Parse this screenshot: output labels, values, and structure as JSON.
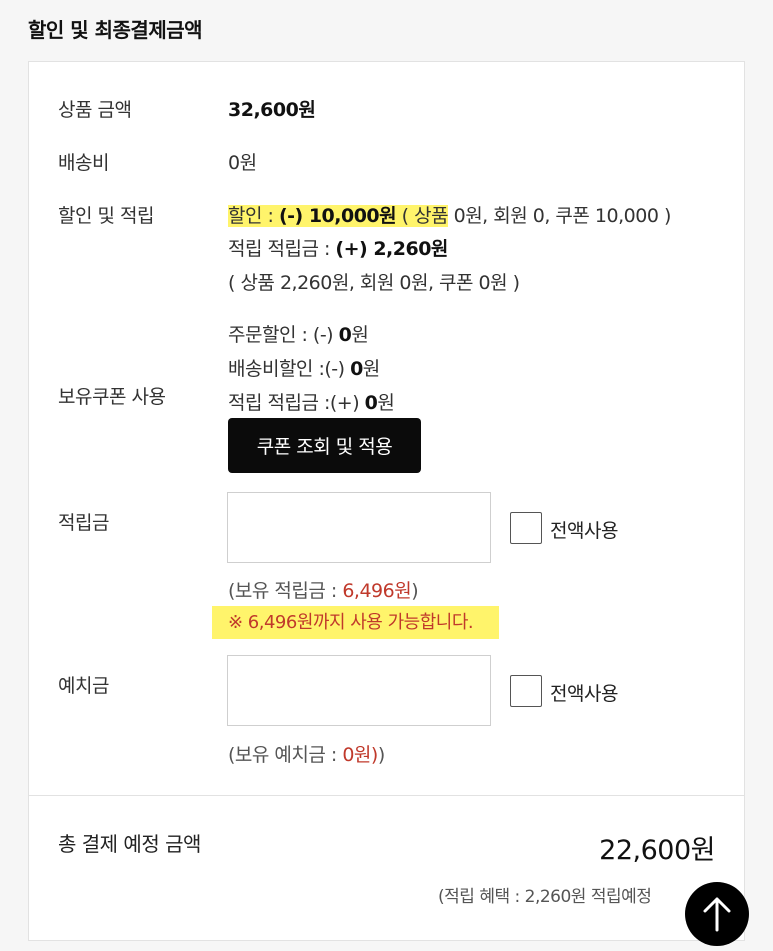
{
  "section_title": "할인 및 최종결제금액",
  "rows": {
    "product_amount": {
      "label": "상품 금액",
      "value": "32,600원"
    },
    "shipping": {
      "label": "배송비",
      "value": "0원"
    },
    "discount": {
      "label": "할인 및 적립",
      "line1_prefix": "할인 : ",
      "line1_amount": "(-) 10,000원",
      "line1_detail_a": " ( 상품",
      "line1_detail_b": " 0원, 회원 0, 쿠폰 10,000 )",
      "line2_prefix": "적립 적립금 : ",
      "line2_amount": "(+) 2,260원",
      "line3": "( 상품 2,260원, 회원 0원, 쿠폰 0원 )"
    },
    "coupon": {
      "label": "보유쿠폰 사용",
      "order_prefix": "주문할인 : (-) ",
      "order_amount": "0",
      "order_unit": "원",
      "ship_prefix": "배송비할인 :(-) ",
      "ship_amount": "0",
      "ship_unit": "원",
      "points_prefix": "적립 적립금 :(+) ",
      "points_amount": "0",
      "points_unit": "원",
      "button_label": "쿠폰 조회 및 적용"
    },
    "points": {
      "label": "적립금",
      "input_value": "",
      "use_all_label": "전액사용",
      "held_prefix": "(보유 적립금 : ",
      "held_amount": "6,496원",
      "held_suffix": ")",
      "notice": "※ 6,496원까지 사용 가능합니다."
    },
    "deposit": {
      "label": "예치금",
      "input_value": "",
      "use_all_label": "전액사용",
      "held_prefix": "(보유 예치금 : ",
      "held_amount": "0원)",
      "held_suffix": ")"
    }
  },
  "total": {
    "label": "총 결제 예정 금액",
    "value": "22,600원",
    "note": "(적립 혜택 : 2,260원 적립예정"
  },
  "icons": {
    "scroll_top": "arrow-up-icon"
  },
  "colors": {
    "accent_red": "#c0392b",
    "highlight": "#fff46b",
    "button_bg": "#0b0b0b"
  }
}
